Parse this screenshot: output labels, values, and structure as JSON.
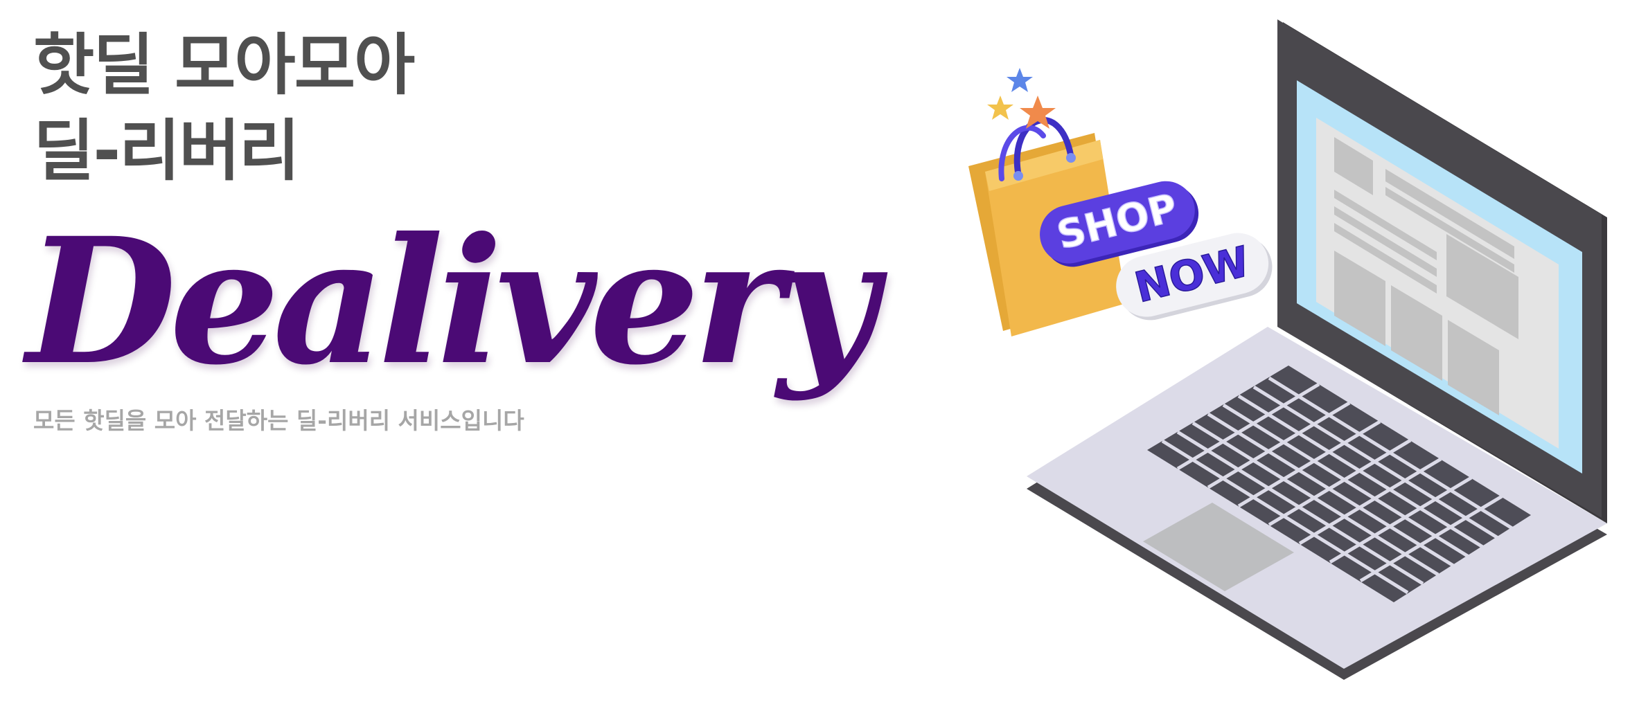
{
  "hero": {
    "headline_line1": "핫딜 모아모아",
    "headline_line2": "딜-리버리",
    "brand_name": "Dealivery",
    "tagline": "모든 핫딜을 모아 전달하는 딜-리버리 서비스입니다"
  },
  "illustration": {
    "badge_shop": "SHOP",
    "badge_now": "NOW",
    "icons": [
      "shopping-bag-icon",
      "star-icon",
      "laptop-icon"
    ]
  },
  "colors": {
    "headline": "#505050",
    "brand": "#4b0a75",
    "tagline": "#a6a6a6",
    "badge_purple": "#5b3fe0",
    "bag_gold": "#f2b84b",
    "laptop_dark": "#4a484d",
    "laptop_body": "#dcdbe8",
    "screen_blue": "#b7e3f8"
  }
}
